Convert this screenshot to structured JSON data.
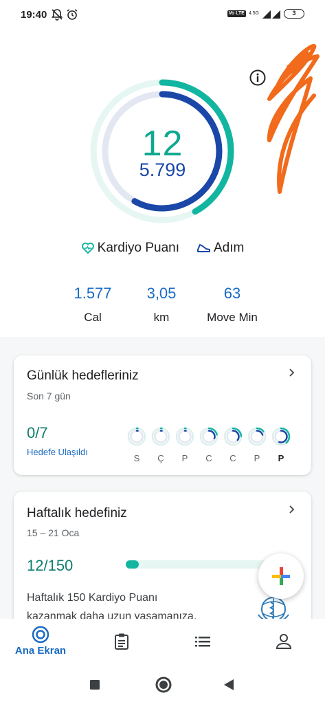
{
  "status_bar": {
    "time": "19:40",
    "network": "4.5G",
    "volte": "Vo LTE",
    "battery": "3"
  },
  "ring": {
    "heart_points": "12",
    "steps": "5.799",
    "heart_progress_fraction": 0.42,
    "steps_progress_fraction": 0.58
  },
  "legend": {
    "heart_label": "Kardiyo Puanı",
    "steps_label": "Adım"
  },
  "stats": [
    {
      "value": "1.577",
      "label": "Cal"
    },
    {
      "value": "3,05",
      "label": "km"
    },
    {
      "value": "63",
      "label": "Move Min"
    }
  ],
  "daily_goals": {
    "title": "Günlük hedefleriniz",
    "subtitle": "Son 7 gün",
    "value": "0/7",
    "link": "Hedefe Ulaşıldı",
    "days": [
      {
        "label": "S",
        "progress": 0.03
      },
      {
        "label": "Ç",
        "progress": 0.03
      },
      {
        "label": "P",
        "progress": 0.03
      },
      {
        "label": "C",
        "progress": 0.3
      },
      {
        "label": "C",
        "progress": 0.35
      },
      {
        "label": "P",
        "progress": 0.2
      },
      {
        "label": "P",
        "progress": 0.55
      }
    ]
  },
  "weekly_goal": {
    "title": "Haftalık hedefiniz",
    "subtitle": "15 – 21 Oca",
    "value": "12/150",
    "progress_fraction": 0.08,
    "description_line1": "Haftalık 150 Kardiyo Puanı",
    "description_line2": "kazanmak daha uzun yaşamanıza,"
  },
  "nav": {
    "home_label": "Ana Ekran"
  },
  "colors": {
    "teal": "#12b5a0",
    "blue": "#1a47a8",
    "link_blue": "#1a6bc4",
    "scribble": "#f26a1b"
  }
}
